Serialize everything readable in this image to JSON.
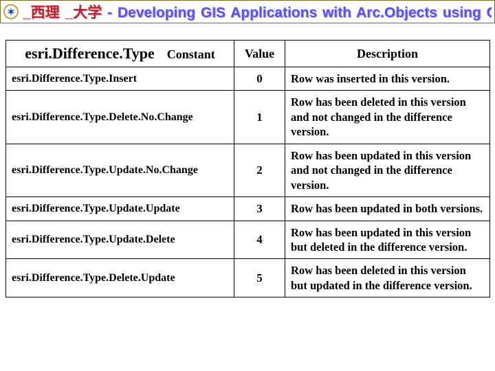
{
  "title": {
    "red": "_西理 _大学",
    "blue": " - Developing GIS Applications with Arc.Objects using C#. NE"
  },
  "table": {
    "header": {
      "type_label": "esri.Difference.Type",
      "constant_label": "Constant",
      "value_label": "Value",
      "description_label": "Description"
    },
    "rows": [
      {
        "constant": "esri.Difference.Type.Insert",
        "value": "0",
        "description": "Row was inserted in this version."
      },
      {
        "constant": "esri.Difference.Type.Delete.No.Change",
        "value": "1",
        "description": "Row has been deleted in this version and not changed in the difference version."
      },
      {
        "constant": "esri.Difference.Type.Update.No.Change",
        "value": "2",
        "description": "Row has been updated in this version and not changed in the difference version."
      },
      {
        "constant": "esri.Difference.Type.Update.Update",
        "value": "3",
        "description": "Row has been updated in both versions."
      },
      {
        "constant": "esri.Difference.Type.Update.Delete",
        "value": "4",
        "description": "Row has been updated in this version but deleted in the difference version."
      },
      {
        "constant": "esri.Difference.Type.Delete.Update",
        "value": "5",
        "description": "Row has been deleted in this version but updated in the difference version."
      }
    ]
  }
}
